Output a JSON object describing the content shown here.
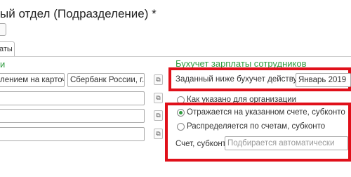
{
  "header": {
    "title": "ый отдел (Подразделение) *"
  },
  "tabs": [
    {
      "label": "аты"
    }
  ],
  "left": {
    "section_title": "и",
    "field1_value": "лением на карточку",
    "field2_value": "Сбербанк России, г. М"
  },
  "right": {
    "section_title": "Бухучет зарплаты сотрудников",
    "effective_label": "Заданный ниже бухучет действует с:",
    "effective_value": "Январь 2019",
    "options": [
      {
        "label": "Как указано для организации",
        "selected": false
      },
      {
        "label": "Отражается на указанном счете, субконто",
        "selected": true
      },
      {
        "label": "Распределяется по счетам, субконто",
        "selected": false
      }
    ],
    "account_label": "Счет, субконто:",
    "account_placeholder": "Подбирается автоматически"
  },
  "icons": {
    "open": "open-icon"
  },
  "colors": {
    "accent": "#2f9b3f",
    "highlight": "#e0101a"
  }
}
